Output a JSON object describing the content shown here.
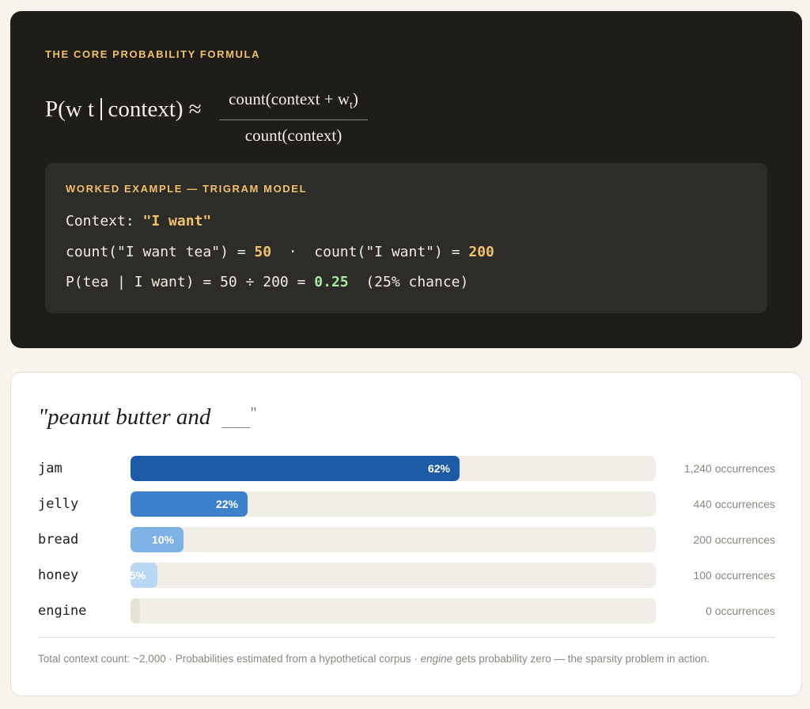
{
  "formula_card": {
    "eyebrow": "THE CORE PROBABILITY FORMULA",
    "lhs_start": "P(w t",
    "lhs_end": "context) ≈",
    "numerator_base": "count(context + w",
    "numerator_sub": "t",
    "numerator_close": ")",
    "denominator": "count(context)"
  },
  "example": {
    "eyebrow": "WORKED EXAMPLE — TRIGRAM MODEL",
    "line1_label": "Context: ",
    "line1_value": "\"I want\"",
    "line2_a": "count(\"I want tea\") = ",
    "line2_a_value": "50",
    "line2_sep": "  ·  ",
    "line2_b": "count(\"I want\") = ",
    "line2_b_value": "200",
    "line3_a": "P(tea | I want) = 50 ÷ 200 = ",
    "line3_value": "0.25",
    "line3_tail": "  (25% chance)"
  },
  "chart": {
    "phrase": "\"peanut butter and",
    "blank": "___",
    "close_quote": "\"",
    "footnote_a": "Total context count: ~2,000 · Probabilities estimated from a hypothetical corpus · ",
    "footnote_em": "engine",
    "footnote_b": " gets probability zero — the sparsity problem in action."
  },
  "chart_data": {
    "type": "bar",
    "orientation": "horizontal",
    "categories": [
      "jam",
      "jelly",
      "bread",
      "honey",
      "engine"
    ],
    "values": [
      62,
      22,
      10,
      5,
      0
    ],
    "value_labels": [
      "62%",
      "22%",
      "10%",
      "5%",
      ""
    ],
    "occurrences": [
      "1,240 occurrences",
      "440 occurrences",
      "200 occurrences",
      "100 occurrences",
      "0 occurrences"
    ],
    "colors": [
      "#1e5ba6",
      "#3d80cc",
      "#7eb2e4",
      "#b9d6f3",
      "#e7e2d8"
    ],
    "xlim": [
      0,
      100
    ]
  }
}
